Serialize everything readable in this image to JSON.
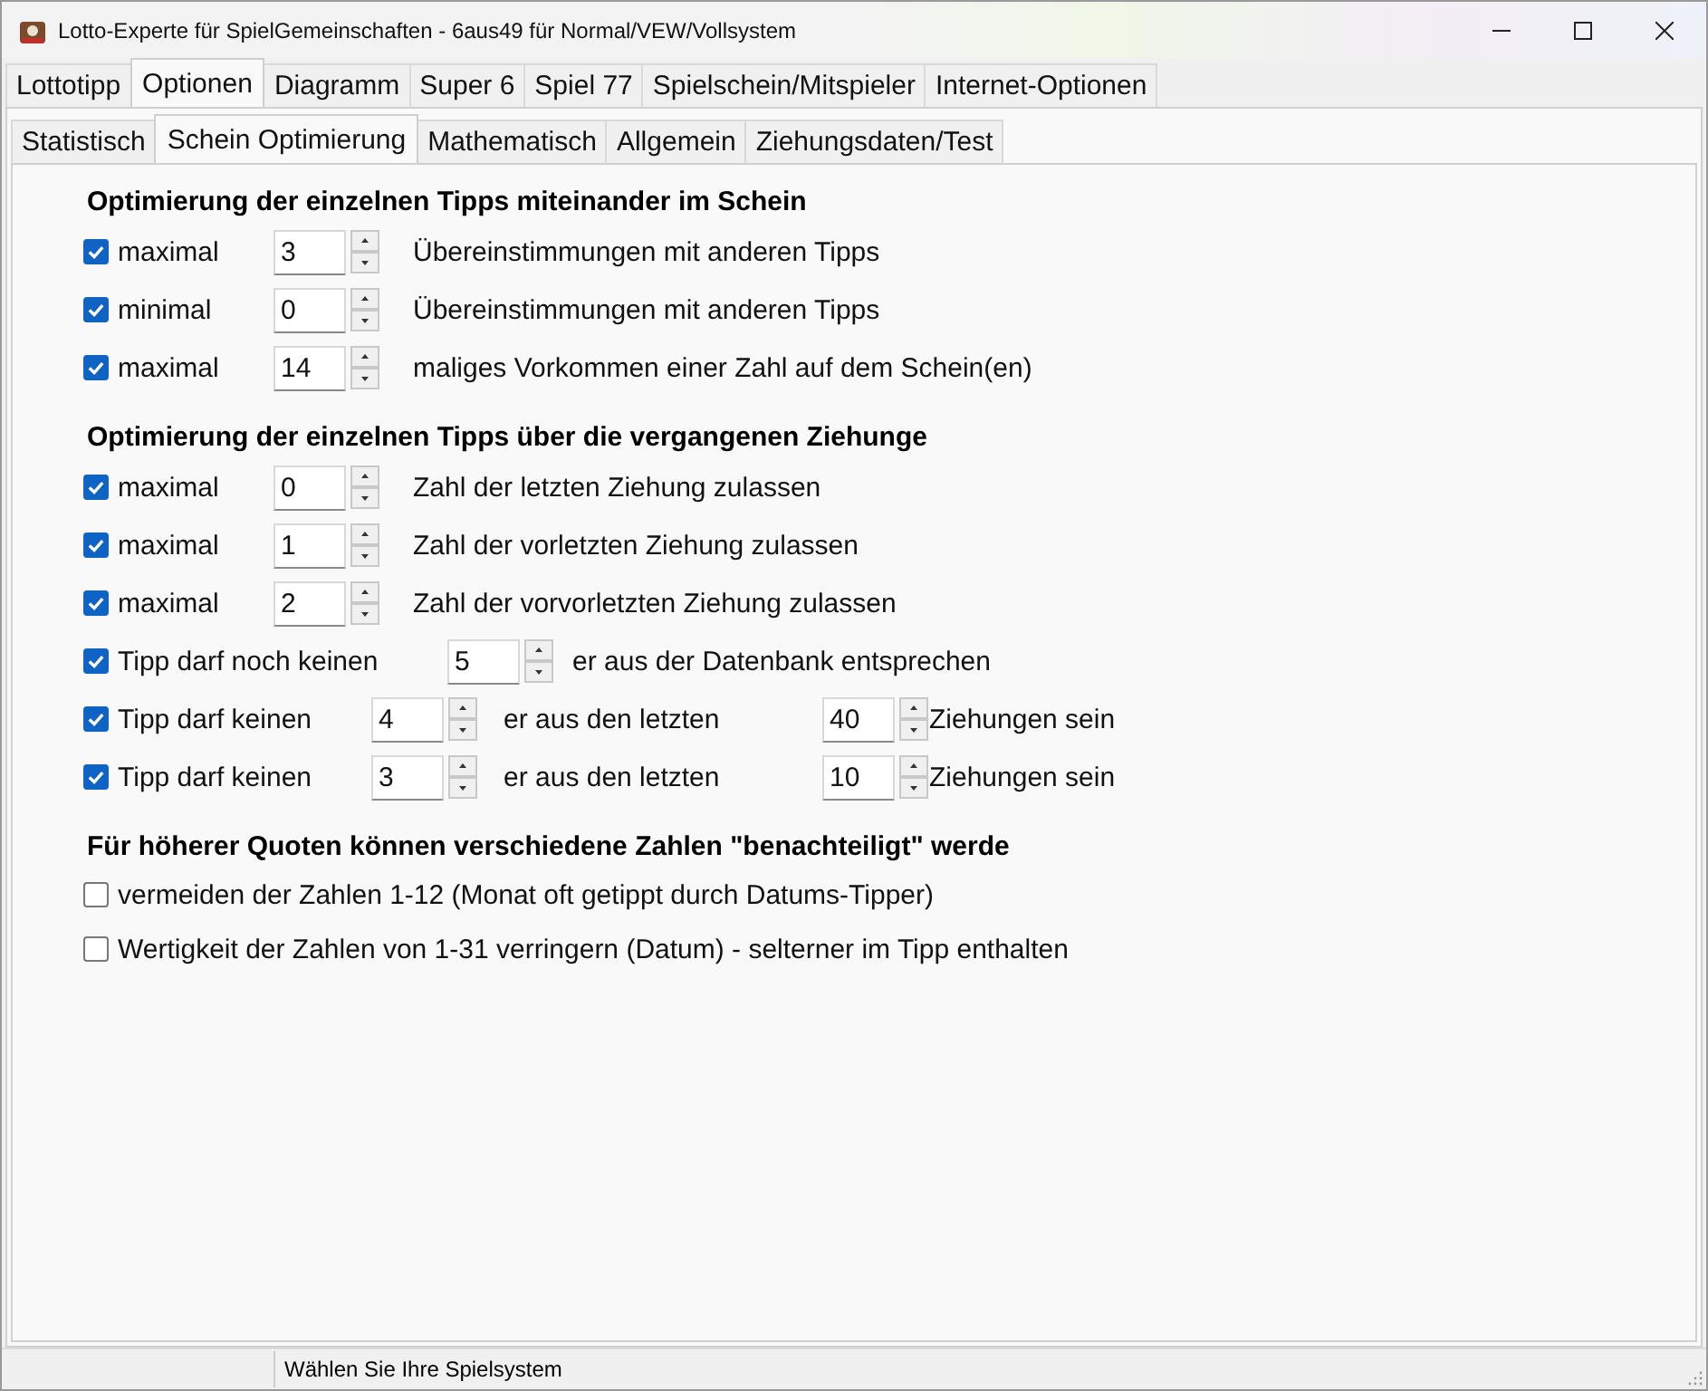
{
  "window": {
    "title": "Lotto-Experte für SpielGemeinschaften - 6aus49 für Normal/VEW/Vollsystem"
  },
  "tabs": [
    {
      "label": "Lottotipp",
      "selected": false
    },
    {
      "label": "Optionen",
      "selected": true
    },
    {
      "label": "Diagramm",
      "selected": false
    },
    {
      "label": "Super 6",
      "selected": false
    },
    {
      "label": "Spiel 77",
      "selected": false
    },
    {
      "label": "Spielschein/Mitspieler",
      "selected": false
    },
    {
      "label": "Internet-Optionen",
      "selected": false
    }
  ],
  "subtabs": [
    {
      "label": "Statistisch",
      "selected": false
    },
    {
      "label": "Schein Optimierung",
      "selected": true
    },
    {
      "label": "Mathematisch",
      "selected": false
    },
    {
      "label": "Allgemein",
      "selected": false
    },
    {
      "label": "Ziehungsdaten/Test",
      "selected": false
    }
  ],
  "sections": [
    {
      "heading": "Optimierung der einzelnen Tipps miteinander im Schein",
      "rows": [
        {
          "kind": "single",
          "checked": true,
          "label": "maximal",
          "value": "3",
          "text": "Übereinstimmungen mit anderen Tipps"
        },
        {
          "kind": "single",
          "checked": true,
          "label": "minimal",
          "value": "0",
          "text": "Übereinstimmungen mit anderen Tipps"
        },
        {
          "kind": "single",
          "checked": true,
          "label": "maximal",
          "value": "14",
          "text": "maliges Vorkommen einer Zahl auf dem Schein(en)"
        }
      ]
    },
    {
      "heading": "Optimierung der einzelnen Tipps über die vergangenen Ziehunge",
      "rows": [
        {
          "kind": "single",
          "checked": true,
          "label": "maximal",
          "value": "0",
          "text": "Zahl der letzten Ziehung zulassen"
        },
        {
          "kind": "single",
          "checked": true,
          "label": "maximal",
          "value": "1",
          "text": "Zahl der vorletzten Ziehung zulassen"
        },
        {
          "kind": "single",
          "checked": true,
          "label": "maximal",
          "value": "2",
          "text": "Zahl der vorvorletzten Ziehung zulassen"
        },
        {
          "kind": "wide",
          "checked": true,
          "label": "Tipp darf noch keinen",
          "value": "5",
          "text": "er aus der Datenbank entsprechen"
        },
        {
          "kind": "double",
          "checked": true,
          "label": "Tipp darf keinen",
          "value": "4",
          "text": "er aus den letzten",
          "value2": "40",
          "text2": "Ziehungen sein"
        },
        {
          "kind": "double",
          "checked": true,
          "label": "Tipp darf keinen",
          "value": "3",
          "text": "er aus den letzten",
          "value2": "10",
          "text2": "Ziehungen sein"
        }
      ]
    },
    {
      "heading": "Für höherer Quoten können verschiedene Zahlen  \"benachteiligt\" werde",
      "rows": [
        {
          "kind": "check",
          "checked": false,
          "label": "vermeiden der Zahlen 1-12 (Monat oft getippt durch Datums-Tipper)"
        },
        {
          "kind": "check",
          "checked": false,
          "label": "Wertigkeit der Zahlen von 1-31 verringern (Datum)  -  selterner im Tipp enthalten"
        }
      ]
    }
  ],
  "status_bar": {
    "text": "Wählen Sie Ihre Spielsystem"
  }
}
